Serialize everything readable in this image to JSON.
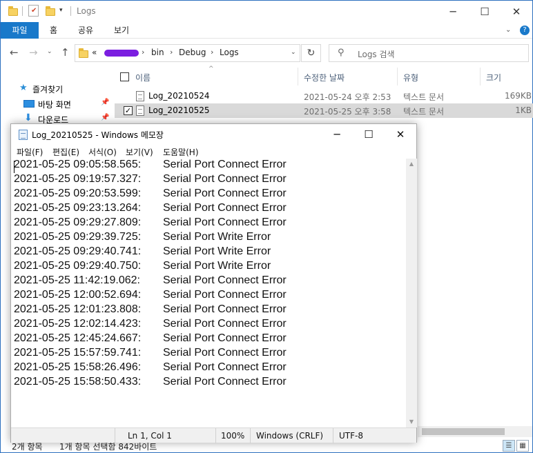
{
  "explorer": {
    "title": "Logs",
    "ribbon_tabs": [
      "파일",
      "홈",
      "공유",
      "보기"
    ],
    "help_icon": "help-icon",
    "breadcrumb": {
      "overflow": "«",
      "segments": [
        "bin",
        "Debug",
        "Logs"
      ]
    },
    "search_placeholder": "Logs 검색",
    "nav_items": [
      {
        "label": "즐겨찾기",
        "icon": "star-icon"
      },
      {
        "label": "바탕 화면",
        "icon": "desktop-icon"
      },
      {
        "label": "다운로드",
        "icon": "download-icon"
      }
    ],
    "columns": [
      "이름",
      "수정한 날짜",
      "유형",
      "크기"
    ],
    "files": [
      {
        "name": "Log_20210524",
        "date": "2021-05-24 오후 2:53",
        "type": "텍스트 문서",
        "size": "169KB",
        "selected": false
      },
      {
        "name": "Log_20210525",
        "date": "2021-05-25 오후 3:58",
        "type": "텍스트 문서",
        "size": "1KB",
        "selected": true
      }
    ],
    "status": {
      "count": "2개 항목",
      "selection": "1개 항목 선택함 842바이트"
    }
  },
  "notepad": {
    "title": "Log_20210525 - Windows 메모장",
    "menu": [
      "파일(F)",
      "편집(E)",
      "서식(O)",
      "보기(V)",
      "도움말(H)"
    ],
    "lines": [
      {
        "ts": "2021-05-25 09:05:58.565:",
        "msg": "Serial Port Connect Error"
      },
      {
        "ts": "2021-05-25 09:19:57.327:",
        "msg": "Serial Port Connect Error"
      },
      {
        "ts": "2021-05-25 09:20:53.599:",
        "msg": "Serial Port Connect Error"
      },
      {
        "ts": "2021-05-25 09:23:13.264:",
        "msg": "Serial Port Connect Error"
      },
      {
        "ts": "2021-05-25 09:29:27.809:",
        "msg": "Serial Port Connect Error"
      },
      {
        "ts": "2021-05-25 09:29:39.725:",
        "msg": "Serial Port Write Error"
      },
      {
        "ts": "2021-05-25 09:29:40.741:",
        "msg": "Serial Port Write Error"
      },
      {
        "ts": "2021-05-25 09:29:40.750:",
        "msg": "Serial Port Write Error"
      },
      {
        "ts": "2021-05-25 11:42:19.062:",
        "msg": "Serial Port Connect Error"
      },
      {
        "ts": "2021-05-25 12:00:52.694:",
        "msg": "Serial Port Connect Error"
      },
      {
        "ts": "2021-05-25 12:01:23.808:",
        "msg": "Serial Port Connect Error"
      },
      {
        "ts": "2021-05-25 12:02:14.423:",
        "msg": "Serial Port Connect Error"
      },
      {
        "ts": "2021-05-25 12:45:24.667:",
        "msg": "Serial Port Connect Error"
      },
      {
        "ts": "2021-05-25 15:57:59.741:",
        "msg": "Serial Port Connect Error"
      },
      {
        "ts": "2021-05-25 15:58:26.496:",
        "msg": "Serial Port Connect Error"
      },
      {
        "ts": "2021-05-25 15:58:50.433:",
        "msg": "Serial Port Connect Error"
      }
    ],
    "status": {
      "position": "Ln 1, Col 1",
      "zoom": "100%",
      "eol": "Windows (CRLF)",
      "encoding": "UTF-8"
    }
  },
  "colors": {
    "accent": "#1979ca",
    "selection": "#d9d9d9",
    "redaction": "#7b1ee0"
  }
}
